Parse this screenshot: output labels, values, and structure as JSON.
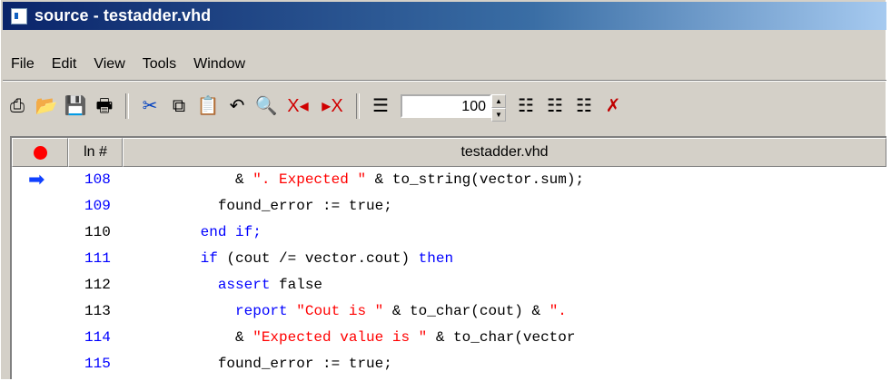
{
  "window": {
    "title": "source - testadder.vhd"
  },
  "menu": [
    "File",
    "Edit",
    "View",
    "Tools",
    "Window"
  ],
  "toolbar": {
    "zoom_value": "100",
    "icons": [
      "compile-icon",
      "open-folder-icon",
      "save-icon",
      "print-icon",
      "cut-icon",
      "copy-icon",
      "paste-icon",
      "undo-icon",
      "find-icon",
      "prev-bookmark-icon",
      "next-bookmark-icon",
      "line-top-icon",
      "line-icon-1",
      "line-icon-2",
      "line-icon-3",
      "clear-icon"
    ]
  },
  "editor": {
    "col_line": "ln #",
    "file_name": "testadder.vhd",
    "colors": {
      "keyword": "#0000ff",
      "string": "#ff0000",
      "exec_line": "#0000ff",
      "breakpoint": "#ff0000"
    },
    "lines": [
      {
        "num": "108",
        "exec": true,
        "indent": "          ",
        "arrow": true,
        "tokens": [
          {
            "t": "& ",
            "c": "plain"
          },
          {
            "t": "\". Expected \"",
            "c": "str"
          },
          {
            "t": " & to_string(vector.sum);",
            "c": "plain"
          }
        ]
      },
      {
        "num": "109",
        "exec": true,
        "indent": "        ",
        "tokens": [
          {
            "t": "found_error := true;",
            "c": "plain"
          }
        ]
      },
      {
        "num": "110",
        "exec": false,
        "indent": "      ",
        "tokens": [
          {
            "t": "end if;",
            "c": "kw"
          }
        ]
      },
      {
        "num": "111",
        "exec": true,
        "indent": "      ",
        "tokens": [
          {
            "t": "if",
            "c": "kw"
          },
          {
            "t": " (cout /= vector.cout) ",
            "c": "plain"
          },
          {
            "t": "then",
            "c": "kw"
          }
        ]
      },
      {
        "num": "112",
        "exec": false,
        "indent": "        ",
        "tokens": [
          {
            "t": "assert",
            "c": "kw"
          },
          {
            "t": " false",
            "c": "plain"
          }
        ]
      },
      {
        "num": "113",
        "exec": false,
        "indent": "          ",
        "tokens": [
          {
            "t": "report",
            "c": "kw"
          },
          {
            "t": " ",
            "c": "plain"
          },
          {
            "t": "\"Cout is \"",
            "c": "str"
          },
          {
            "t": " & to_char(cout) & ",
            "c": "plain"
          },
          {
            "t": "\".",
            "c": "str"
          }
        ]
      },
      {
        "num": "114",
        "exec": true,
        "indent": "          ",
        "tokens": [
          {
            "t": "& ",
            "c": "plain"
          },
          {
            "t": "\"Expected value is \"",
            "c": "str"
          },
          {
            "t": " & to_char(vector",
            "c": "plain"
          }
        ]
      },
      {
        "num": "115",
        "exec": true,
        "indent": "        ",
        "tokens": [
          {
            "t": "found_error := true;",
            "c": "plain"
          }
        ]
      }
    ]
  }
}
